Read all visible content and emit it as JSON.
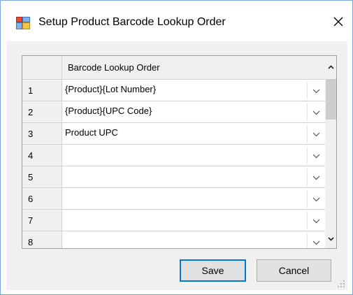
{
  "window": {
    "title": "Setup Product Barcode Lookup Order"
  },
  "icons": {
    "app": "application-form-icon",
    "close": "close-icon"
  },
  "grid": {
    "column_header": "Barcode Lookup Order",
    "rows": [
      {
        "num": "1",
        "value": "{Product}{Lot Number}"
      },
      {
        "num": "2",
        "value": "{Product}{UPC Code}"
      },
      {
        "num": "3",
        "value": "Product UPC"
      },
      {
        "num": "4",
        "value": ""
      },
      {
        "num": "5",
        "value": ""
      },
      {
        "num": "6",
        "value": ""
      },
      {
        "num": "7",
        "value": ""
      },
      {
        "num": "8",
        "value": ""
      }
    ]
  },
  "buttons": {
    "save": "Save",
    "cancel": "Cancel"
  },
  "colors": {
    "window_border": "#7aa7d6",
    "client_bg": "#f0f0f0",
    "focus_border": "#0078d7"
  }
}
